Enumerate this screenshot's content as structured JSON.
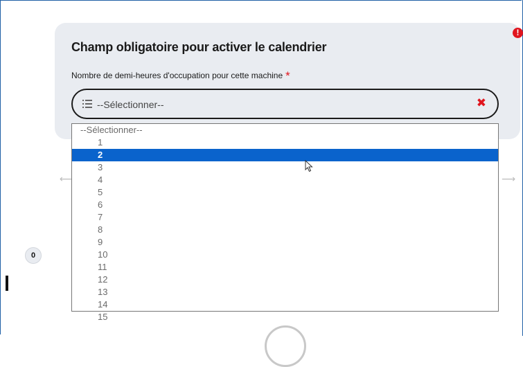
{
  "card": {
    "title": "Champ obligatoire pour activer le calendrier",
    "field_label": "Nombre de demi-heures d'occupation pour cette machine",
    "required_mark": "*",
    "alert_mark": "!"
  },
  "select": {
    "value": "--Sélectionner--",
    "clear_mark": "✖"
  },
  "dropdown": {
    "selected_index": 2,
    "options": [
      "--Sélectionner--",
      "1",
      "2",
      "3",
      "4",
      "5",
      "6",
      "7",
      "8",
      "9",
      "10",
      "11",
      "12",
      "13",
      "14",
      "15"
    ]
  },
  "background": {
    "counter": "0",
    "arrow_left": "⟵",
    "arrow_right": "⟶"
  },
  "icons": {
    "alert": "alert-circle-icon",
    "list": "list-icon",
    "clear": "close-icon",
    "cursor": "mouse-pointer-icon"
  },
  "colors": {
    "accent": "#0a63cc",
    "danger": "#e0151e",
    "card_bg": "#e9ecf1",
    "frame": "#1f5fa6"
  }
}
